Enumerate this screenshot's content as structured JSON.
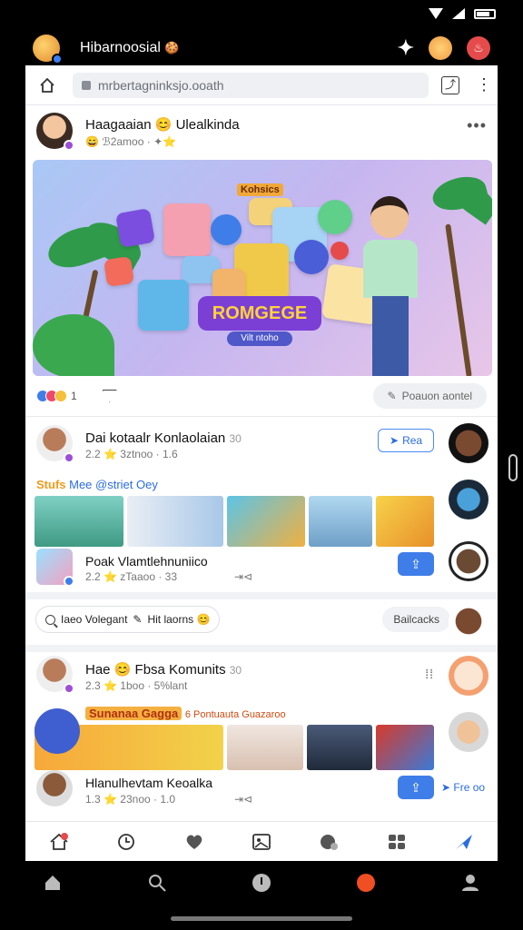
{
  "app": {
    "title": "Hibarnoosial",
    "title_emoji": "🍪"
  },
  "browser": {
    "url": "mrbertagninksjo.ooath"
  },
  "post1": {
    "author": "Haagaaian 😊 Ulealkinda",
    "meta": "😄 ℬ2amoo · ✦⭐",
    "hero_tag": "Kohsics",
    "hero_title": "ROMGEGE",
    "hero_subtitle": "Vilt ntoho",
    "reaction_count": "1",
    "react_button": "Poauon aontel"
  },
  "post2": {
    "author": "Dai kotaalr Konlaolaian",
    "author_suffix": "30",
    "meta": "2.2 ⭐ 3ztnoo · 1.6",
    "follow_label": "Rea",
    "strip_title_prefix": "Stufs",
    "strip_title": "Mee @striet Oey",
    "sub_author": "Poak Vlamtlehnuniico",
    "sub_meta": "2.2 ⭐ zTaaoo · 33",
    "sub_meta_right": "⇥⊲"
  },
  "search": {
    "left_text": "Iaeo Volegant",
    "left_text2": "Hit laorns 😊",
    "chip_right": "Bailcacks"
  },
  "post3": {
    "author": "Hae 😊 Fbsa Komunits",
    "author_suffix": "30",
    "meta": "2.3 ⭐ 1boo · 5%lant",
    "strip_title": "Sunanaa Gagga",
    "strip_suffix": "6 Pontuauta Guazaroo",
    "sub_author": "Hlanulhevtam Keoalka",
    "sub_meta": "1.3 ⭐ 23noo · 1.0",
    "sub_meta_right": "⇥⊲",
    "right_tail": "Fre oo"
  },
  "icons": [
    "home-icon",
    "lock-icon",
    "share-icon",
    "more-icon",
    "search-icon",
    "heart-icon",
    "gallery-icon",
    "friends-icon",
    "send-icon",
    "profile-icon"
  ],
  "colors": {
    "brand_blue": "#3f7ee8",
    "badge_purple": "#9c4ed8",
    "hero_pill": "#7b3fd6",
    "hero_pill_text": "#ffd23a",
    "live_red": "#f04e23"
  }
}
